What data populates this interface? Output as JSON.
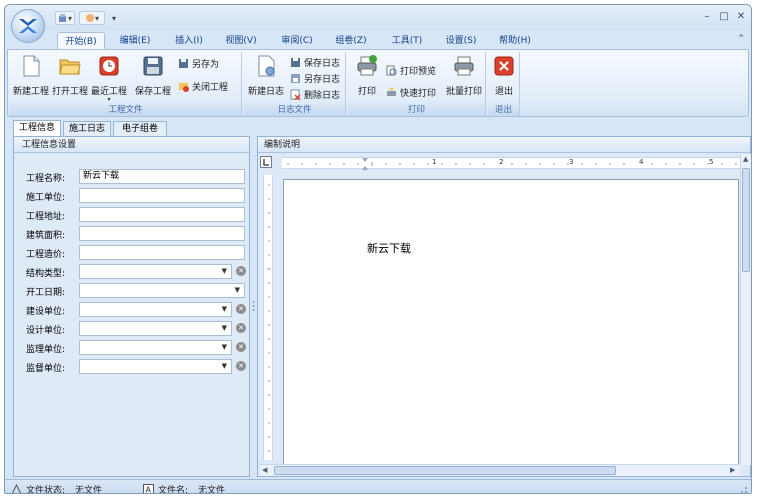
{
  "quick_access": {
    "undo": "▾",
    "hand": "▾",
    "more": "▾"
  },
  "window": {
    "minimize": "–",
    "maximize": "□",
    "close": "✕"
  },
  "tabs": [
    {
      "label": "开始(B)",
      "active": true
    },
    {
      "label": "编辑(E)"
    },
    {
      "label": "插入(I)"
    },
    {
      "label": "视图(V)"
    },
    {
      "label": "审阅(C)"
    },
    {
      "label": "组卷(Z)"
    },
    {
      "label": "工具(T)"
    },
    {
      "label": "设置(S)"
    },
    {
      "label": "帮助(H)"
    }
  ],
  "ribbon": {
    "groups": {
      "project": {
        "label": "工程文件",
        "new": "新建工程",
        "open": "打开工程",
        "recent": "最近工程",
        "save": "保存工程",
        "save_as": "另存为",
        "close": "关闭工程"
      },
      "log": {
        "label": "日志文件",
        "new": "新建日志",
        "save": "保存日志",
        "save_as": "另存日志",
        "delete": "删除日志"
      },
      "print": {
        "label": "打印",
        "print": "打印",
        "preview": "打印预览",
        "quick": "快速打印",
        "batch": "批量打印"
      },
      "exit": {
        "label": "退出",
        "exit": "退出"
      }
    }
  },
  "left_tabs": [
    "工程信息",
    "施工日志",
    "电子组卷"
  ],
  "left_panel": {
    "header": "工程信息设置",
    "fields": [
      {
        "label": "工程名称:",
        "value": "新云下载",
        "kind": "text"
      },
      {
        "label": "施工单位:",
        "value": "",
        "kind": "text"
      },
      {
        "label": "工程地址:",
        "value": "",
        "kind": "text"
      },
      {
        "label": "建筑面积:",
        "value": "",
        "kind": "text"
      },
      {
        "label": "工程造价:",
        "value": "",
        "kind": "text"
      },
      {
        "label": "结构类型:",
        "value": "",
        "kind": "combo"
      },
      {
        "label": "开工日期:",
        "value": "",
        "kind": "combo-noclear"
      },
      {
        "label": "建设单位:",
        "value": "",
        "kind": "combo"
      },
      {
        "label": "设计单位:",
        "value": "",
        "kind": "combo"
      },
      {
        "label": "监理单位:",
        "value": "",
        "kind": "combo"
      },
      {
        "label": "监督单位:",
        "value": "",
        "kind": "combo"
      }
    ]
  },
  "right_panel": {
    "header": "编制说明",
    "document_text": "新云下载",
    "ruler_numbers": [
      "1",
      "2",
      "3",
      "4",
      "5"
    ]
  },
  "status": {
    "file_state_label": "文件状态:",
    "file_state_value": "无文件",
    "file_name_label": "文件名:",
    "file_name_value": "无文件"
  }
}
